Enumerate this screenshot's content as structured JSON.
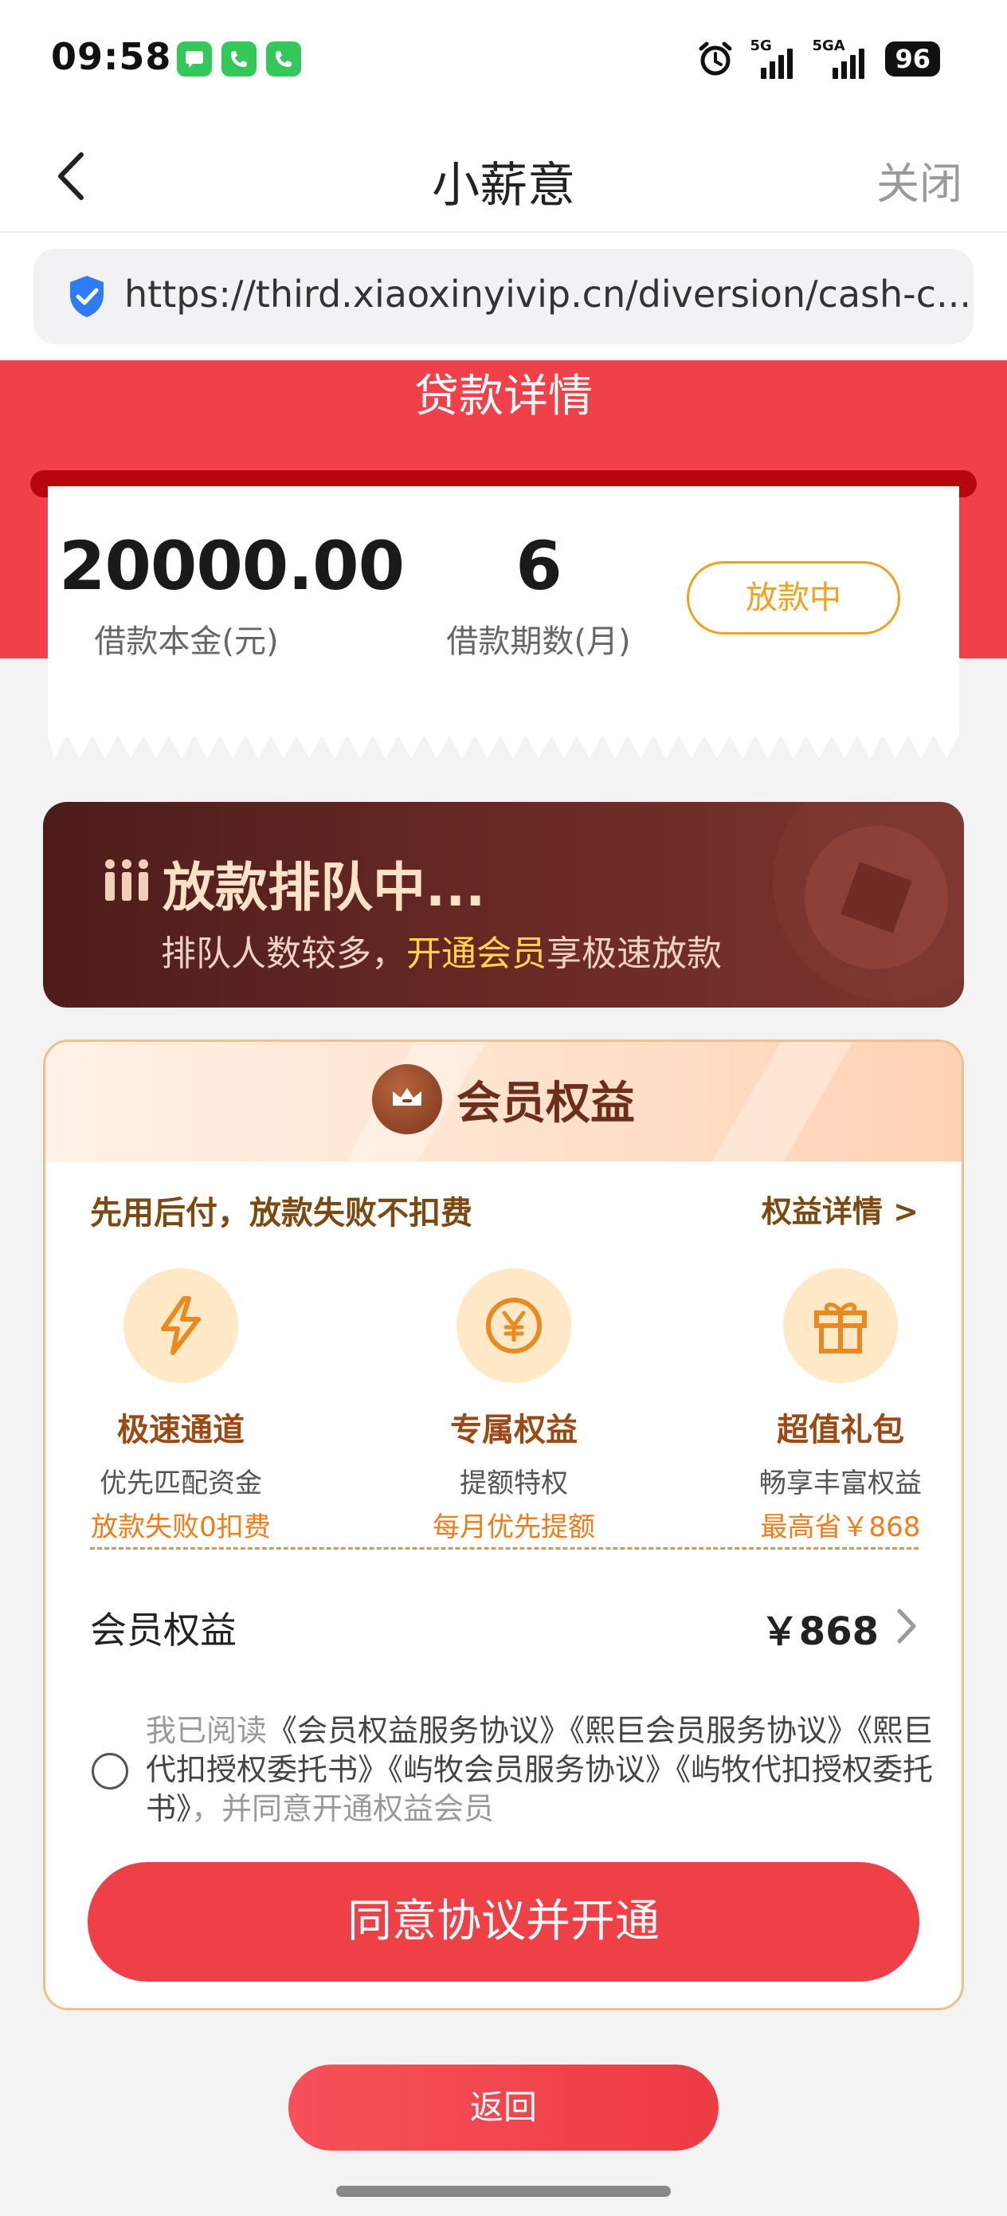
{
  "status_bar": {
    "time": "09:58",
    "net1": "5G",
    "net2": "5GA",
    "battery": "96",
    "apps": [
      "messages-app-icon",
      "phone-app-icon",
      "phone-app-icon"
    ]
  },
  "nav": {
    "title": "小薪意",
    "close": "关闭"
  },
  "url": "https://third.xiaoxinyivip.cn/diversion/cash-c...",
  "loan": {
    "section_title": "贷款详情",
    "principal": "20000.00",
    "principal_label": "借款本金(元)",
    "periods": "6",
    "periods_label": "借款期数(月)",
    "status": "放款中"
  },
  "queue": {
    "title": "放款排队中...",
    "sub_prefix": "排队人数较多，",
    "sub_highlight": "开通会员",
    "sub_suffix": "享极速放款"
  },
  "member": {
    "title": "会员权益",
    "promo": "先用后付，放款失败不扣费",
    "detail_link": "权益详情 >",
    "features": [
      {
        "title": "极速通道",
        "line1": "优先匹配资金",
        "line2": "放款失败0扣费",
        "icon": "lightning-icon"
      },
      {
        "title": "专属权益",
        "line1": "提额特权",
        "line2": "每月优先提额",
        "icon": "yen-coin-icon"
      },
      {
        "title": "超值礼包",
        "line1": "畅享丰富权益",
        "line2": "最高省￥868",
        "icon": "gift-icon"
      }
    ],
    "rights_label": "会员权益",
    "rights_price": "￥868",
    "agreement": {
      "prefix": "我已阅读",
      "link1": "《会员权益服务协议》",
      "link2": "《熙巨会员服务协议》",
      "link3": "《熙巨代扣授权委托书》",
      "link4": "《屿牧会员服务协议》",
      "link5": "《屿牧代扣授权委托书》",
      "suffix": "，并同意开通权益会员"
    },
    "cta": "同意协议并开通"
  },
  "back_button": "返回",
  "colors": {
    "brand_red": "#f0414a",
    "status_orange": "#f0a21c",
    "queue_brown": "#4d1d1b",
    "highlight_yellow": "#ffd54a"
  }
}
